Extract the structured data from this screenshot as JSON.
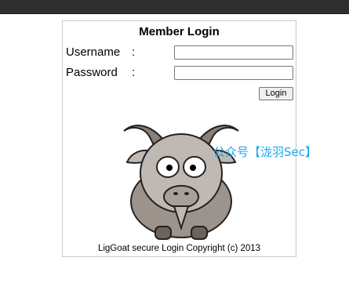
{
  "login": {
    "title": "Member Login",
    "username_label": "Username",
    "password_label": "Password",
    "colon": ":",
    "username_value": "",
    "password_value": "",
    "button_label": "Login"
  },
  "footer": {
    "copyright": "LigGoat secure Login Copyright (c) 2013"
  },
  "watermark": {
    "text": "公众号【泷羽Sec】"
  },
  "colors": {
    "top_bar": "#2f2f2f",
    "watermark": "#18a9f0",
    "box_border": "#c8c8c8"
  },
  "icons": {
    "goat": "goat-mascot-image"
  }
}
